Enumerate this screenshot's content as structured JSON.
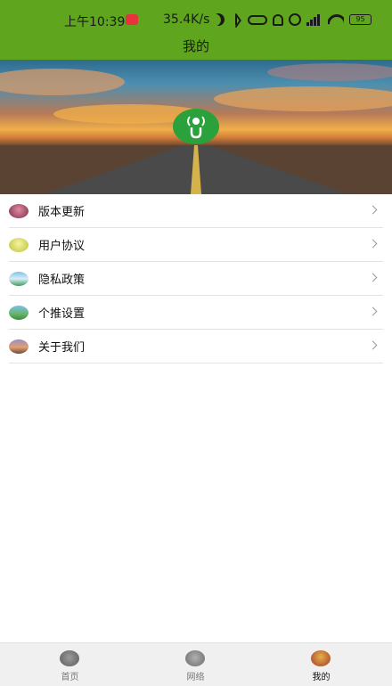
{
  "status_bar": {
    "time": "上午10:39",
    "net_speed": "35.4K/s",
    "battery": "95",
    "icons": [
      "weibo-icon",
      "moon-icon",
      "bluetooth-icon",
      "nfc-icon",
      "mute-icon",
      "alarm-icon",
      "signal-icon",
      "wifi-icon",
      "battery-icon"
    ]
  },
  "header": {
    "title": "我的"
  },
  "menu": {
    "items": [
      {
        "label": "版本更新",
        "icon": "version-update-icon"
      },
      {
        "label": "用户协议",
        "icon": "user-agreement-icon"
      },
      {
        "label": "隐私政策",
        "icon": "privacy-policy-icon"
      },
      {
        "label": "个推设置",
        "icon": "push-settings-icon"
      },
      {
        "label": "关于我们",
        "icon": "about-us-icon"
      }
    ]
  },
  "tab_bar": {
    "tabs": [
      {
        "label": "首页",
        "icon": "home-icon",
        "active": false
      },
      {
        "label": "网络",
        "icon": "network-icon",
        "active": false
      },
      {
        "label": "我的",
        "icon": "mine-icon",
        "active": true
      }
    ]
  },
  "colors": {
    "header": "#5fa51e",
    "logo": "#2aa13a",
    "divider": "#e3e3e3",
    "tab_bar": "#f0f0f0"
  }
}
